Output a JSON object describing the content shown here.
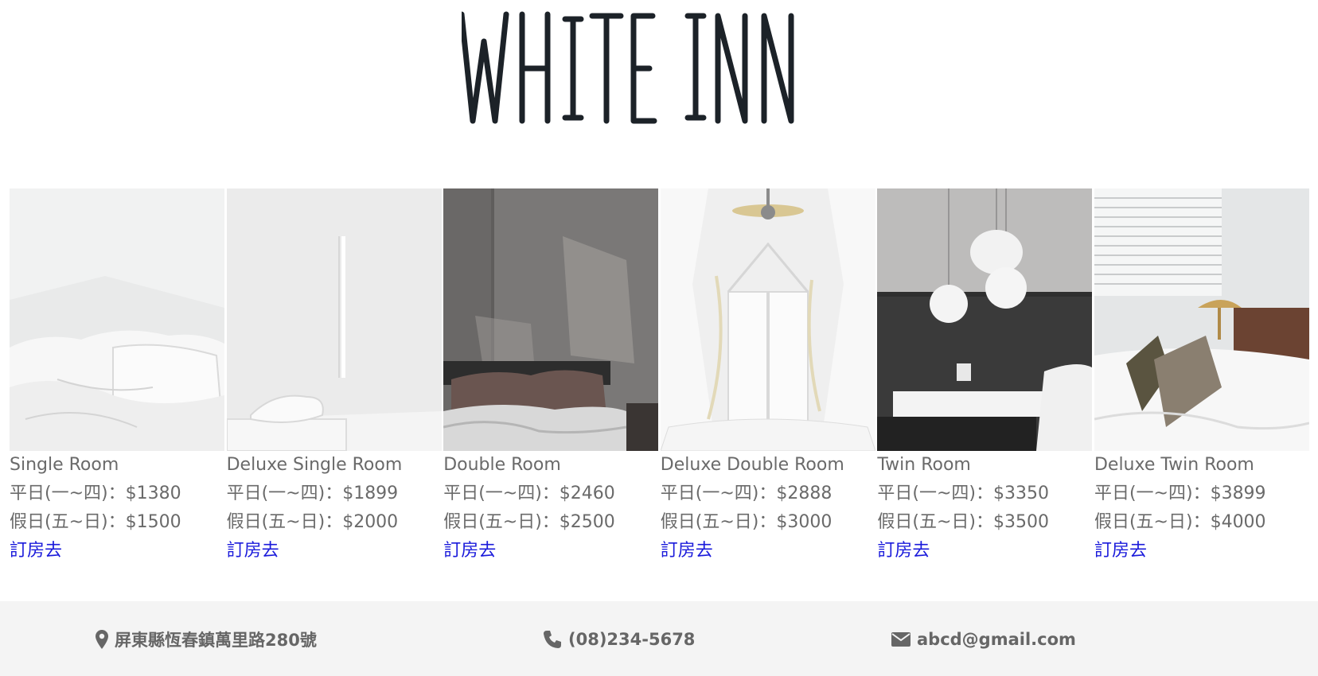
{
  "header": {
    "logo_text": "WHITE INN"
  },
  "rooms": [
    {
      "name": "Single Room",
      "weekday": "平日(一~四)：$1380",
      "weekend": "假日(五~日)：$1500",
      "link": "訂房去"
    },
    {
      "name": "Deluxe Single Room",
      "weekday": "平日(一~四)：$1899",
      "weekend": "假日(五~日)：$2000",
      "link": "訂房去"
    },
    {
      "name": "Double Room",
      "weekday": "平日(一~四)：$2460",
      "weekend": "假日(五~日)：$2500",
      "link": "訂房去"
    },
    {
      "name": "Deluxe Double Room",
      "weekday": "平日(一~四)：$2888",
      "weekend": "假日(五~日)：$3000",
      "link": "訂房去"
    },
    {
      "name": "Twin Room",
      "weekday": "平日(一~四)：$3350",
      "weekend": "假日(五~日)：$3500",
      "link": "訂房去"
    },
    {
      "name": "Deluxe Twin Room",
      "weekday": "平日(一~四)：$3899",
      "weekend": "假日(五~日)：$4000",
      "link": "訂房去"
    }
  ],
  "footer": {
    "address": "屏東縣恆春鎮萬里路280號",
    "phone": "(08)234-5678",
    "email": "abcd@gmail.com"
  },
  "icons": {
    "address": "map-marker-icon",
    "phone": "phone-icon",
    "email": "envelope-icon"
  },
  "colors": {
    "link": "#1a1adb",
    "text": "#666666",
    "footer_bg": "#f4f4f4",
    "logo": "#1c2228"
  }
}
